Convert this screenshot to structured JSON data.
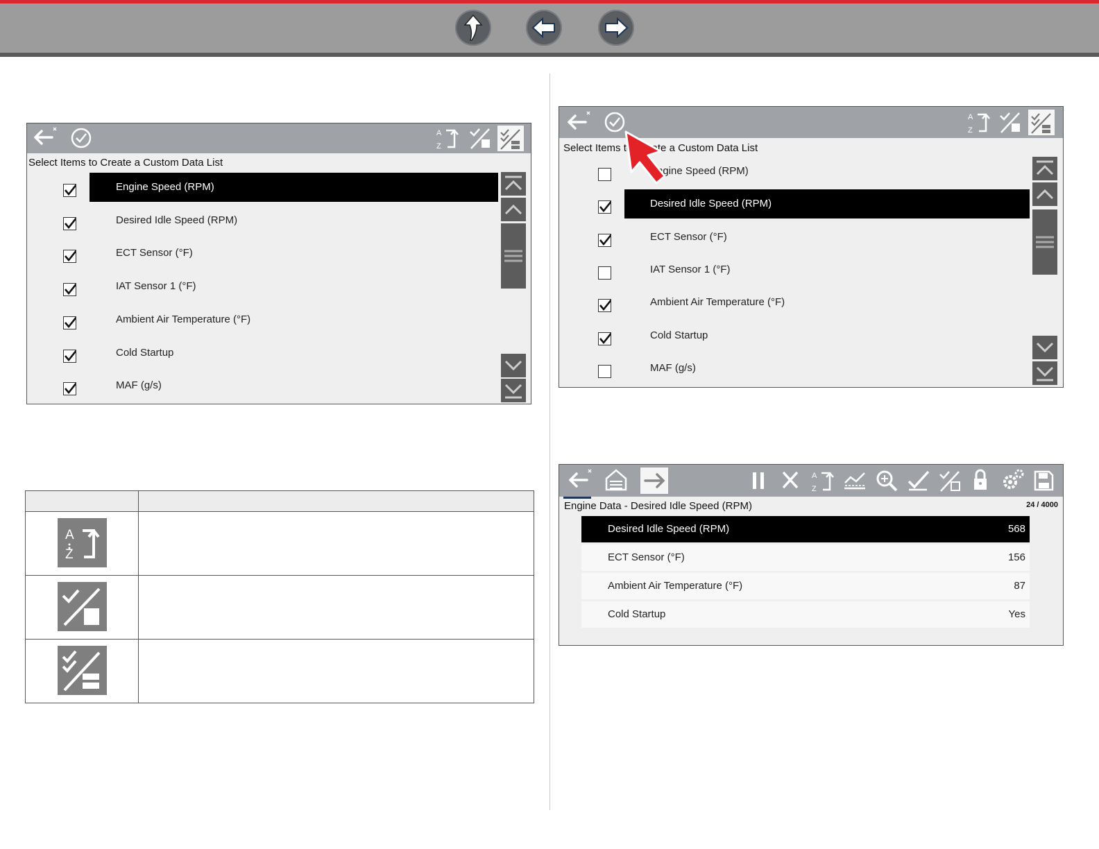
{
  "nav": {
    "up_icon": "up-arrow-icon",
    "back_icon": "left-arrow-icon",
    "forward_icon": "right-arrow-icon"
  },
  "screen1": {
    "caption": "Select Items to Create a Custom Data List",
    "items": [
      {
        "label": "Engine Speed (RPM)",
        "checked": true,
        "selected": true
      },
      {
        "label": "Desired Idle Speed (RPM)",
        "checked": true,
        "selected": false
      },
      {
        "label": "ECT Sensor (°F)",
        "checked": true,
        "selected": false
      },
      {
        "label": "IAT Sensor 1 (°F)",
        "checked": true,
        "selected": false
      },
      {
        "label": "Ambient Air Temperature (°F)",
        "checked": true,
        "selected": false
      },
      {
        "label": "Cold Startup",
        "checked": true,
        "selected": false
      },
      {
        "label": "MAF (g/s)",
        "checked": true,
        "selected": false
      }
    ]
  },
  "screen2": {
    "caption": "Select Items to Create a Custom Data List",
    "items": [
      {
        "label": "Engine Speed (RPM)",
        "checked": false,
        "selected": false
      },
      {
        "label": "Desired Idle Speed (RPM)",
        "checked": true,
        "selected": true
      },
      {
        "label": "ECT Sensor (°F)",
        "checked": true,
        "selected": false
      },
      {
        "label": "IAT Sensor 1 (°F)",
        "checked": false,
        "selected": false
      },
      {
        "label": "Ambient Air Temperature (°F)",
        "checked": true,
        "selected": false
      },
      {
        "label": "Cold Startup",
        "checked": true,
        "selected": false
      },
      {
        "label": "MAF (g/s)",
        "checked": false,
        "selected": false
      }
    ]
  },
  "screen3": {
    "caption": "Engine Data - Desired Idle Speed (RPM)",
    "counter": "24 / 4000",
    "rows": [
      {
        "label": "Desired Idle Speed (RPM)",
        "value": "568",
        "selected": true
      },
      {
        "label": "ECT Sensor (°F)",
        "value": "156",
        "selected": false
      },
      {
        "label": "Ambient Air Temperature (°F)",
        "value": "87",
        "selected": false
      },
      {
        "label": "Cold Startup",
        "value": "Yes",
        "selected": false
      }
    ]
  },
  "icon_table": {
    "header": [
      "",
      ""
    ],
    "rows": [
      {
        "icon": "sort-az-icon",
        "description": ""
      },
      {
        "icon": "select-deselect-icon",
        "description": ""
      },
      {
        "icon": "select-all-deselect-all-icon",
        "description": ""
      }
    ]
  },
  "colors": {
    "accent_red": "#d9282f",
    "toolbar_gray": "#9fa3a8",
    "selected_row": "#000000"
  }
}
